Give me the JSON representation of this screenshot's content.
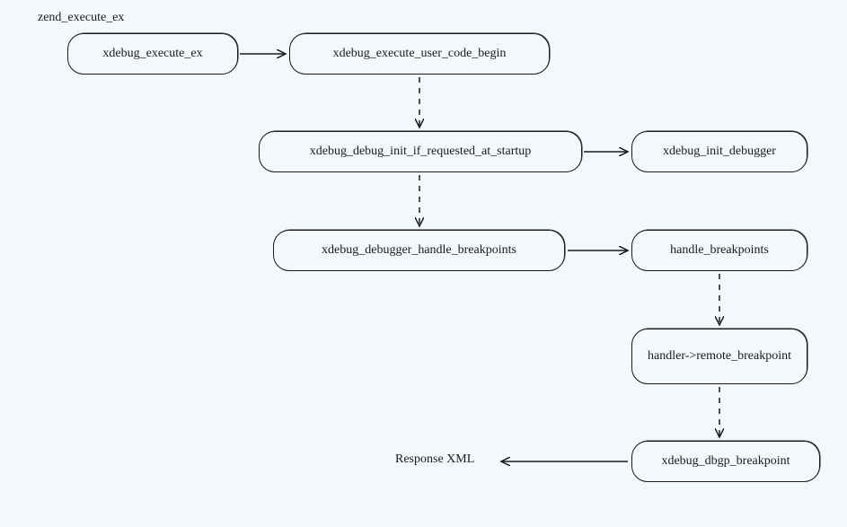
{
  "diagram": {
    "title": "zend_execute_ex",
    "nodes": {
      "n1": "xdebug_execute_ex",
      "n2": "xdebug_execute_user_code_begin",
      "n3": "xdebug_debug_init_if_requested_at_startup",
      "n4": "xdebug_init_debugger",
      "n5": "xdebug_debugger_handle_breakpoints",
      "n6": "handle_breakpoints",
      "n7": "handler->remote_breakpoint",
      "n8": "xdebug_dbgp_breakpoint"
    },
    "labels": {
      "response": "Response XML"
    }
  }
}
